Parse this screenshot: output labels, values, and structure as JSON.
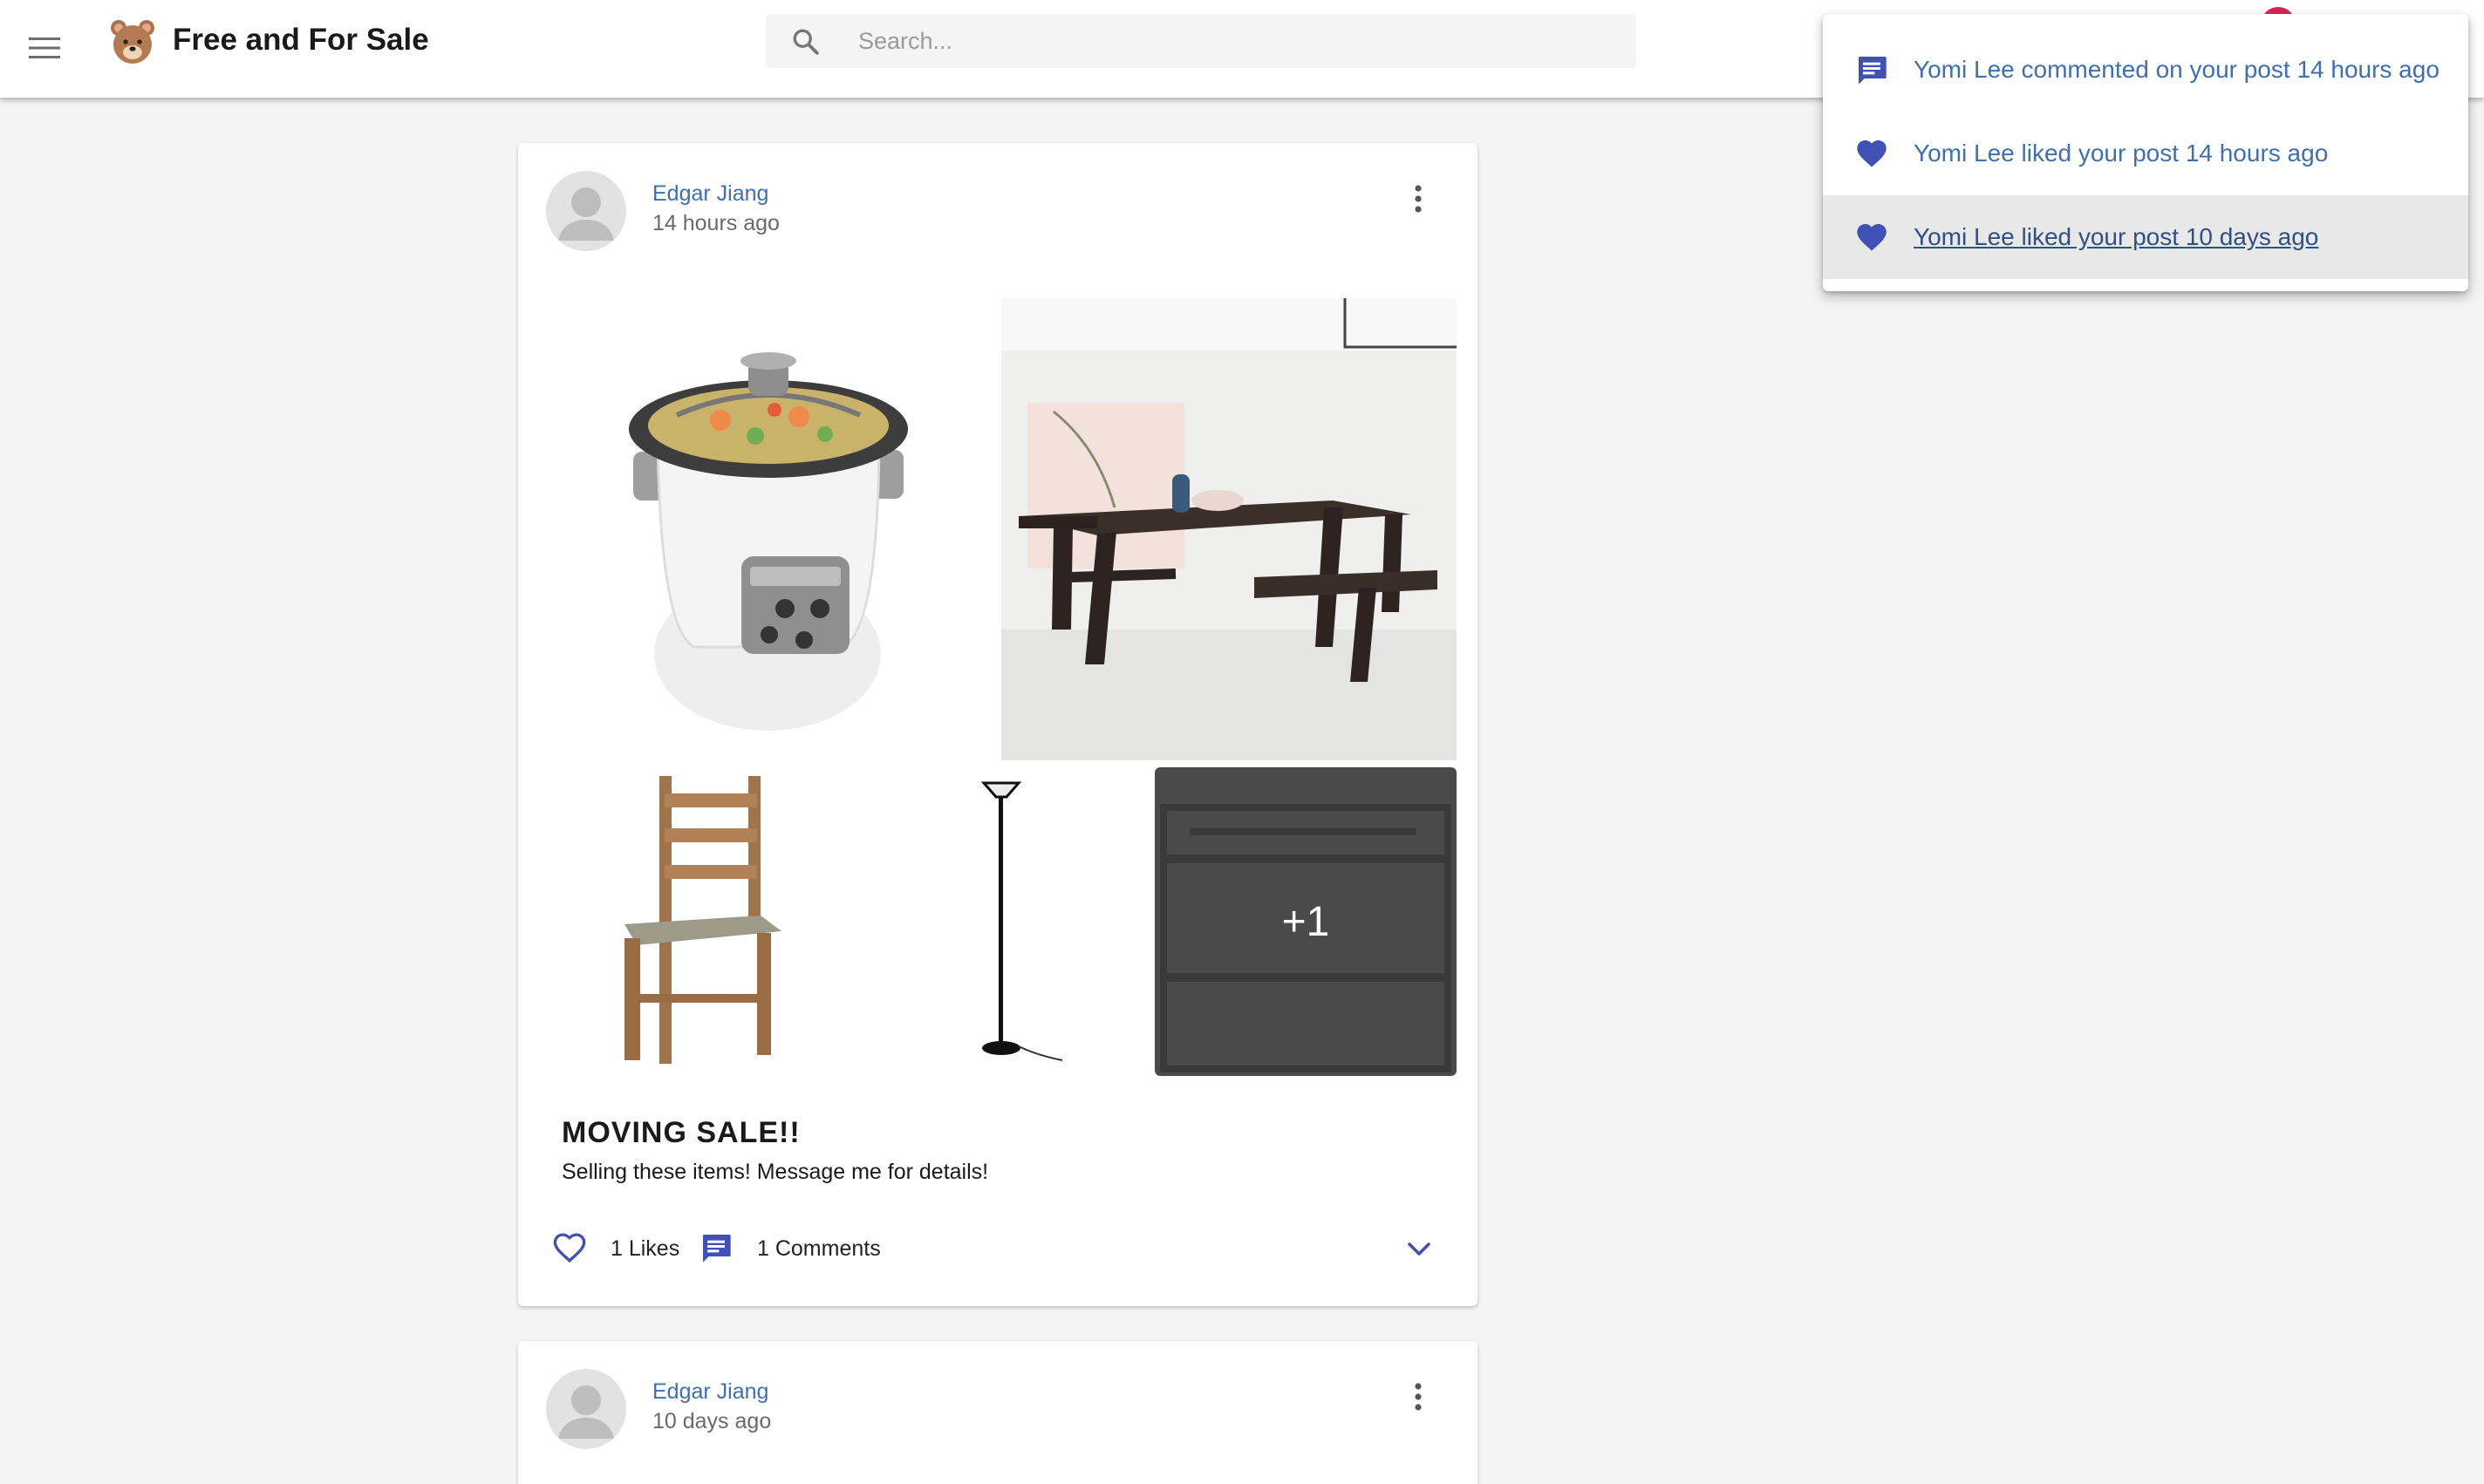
{
  "appbar": {
    "title": "Free and For Sale",
    "logo_icon": "bear-logo-icon",
    "menu_icon": "hamburger-menu-icon",
    "search": {
      "placeholder": "Search...",
      "value": "",
      "icon": "search-icon"
    },
    "notification_badge_color": "#e0234e"
  },
  "notifications": [
    {
      "icon": "comment-icon",
      "text": "Yomi Lee commented on your post 14 hours ago",
      "active": false
    },
    {
      "icon": "heart-icon",
      "text": "Yomi Lee liked your post 14 hours ago",
      "active": false
    },
    {
      "icon": "heart-icon",
      "text": "Yomi Lee liked your post 10 days ago",
      "active": true
    }
  ],
  "posts": [
    {
      "author": "Edgar Jiang",
      "time": "14 hours ago",
      "photos": [
        "rice cooker",
        "dining table",
        "wooden chair",
        "floor lamp",
        "bunk bed"
      ],
      "more_photos": "+1",
      "title": "MOVING SALE!!",
      "body": "Selling these items! Message me for details!",
      "likes": "1 Likes",
      "comments": "1 Comments"
    },
    {
      "author": "Edgar Jiang",
      "time": "10 days ago"
    }
  ],
  "colors": {
    "accent": "#3f51b5",
    "link": "#3f6fb3",
    "background": "#f4f4f4"
  }
}
